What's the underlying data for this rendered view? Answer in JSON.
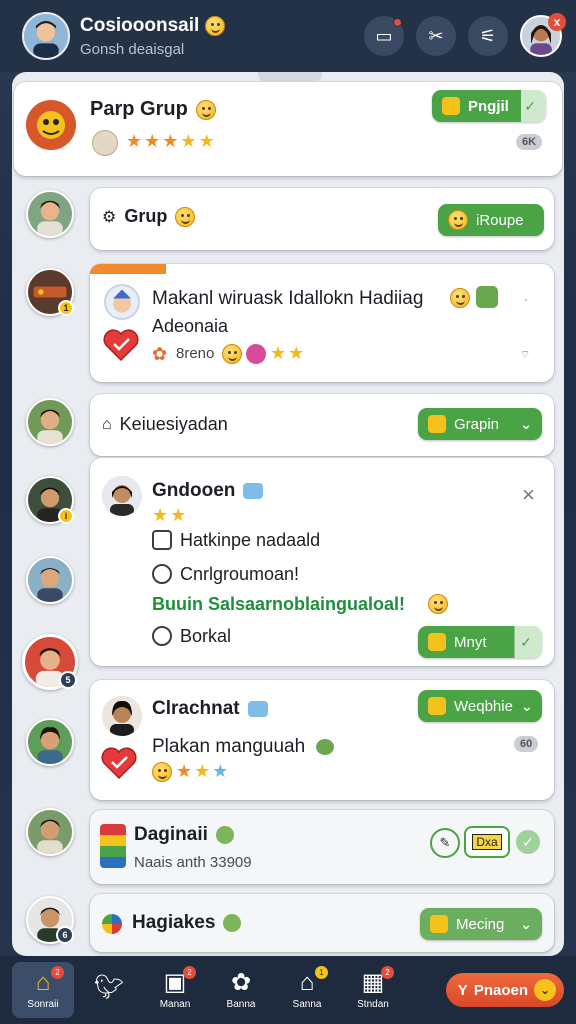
{
  "header": {
    "title": "Cosiooonsail",
    "subtitle": "Gonsh deaisgal",
    "icons": [
      "video-chat-icon",
      "tools-icon",
      "sliders-icon"
    ],
    "close_label": "x"
  },
  "rows": [
    {
      "title": "Parp Grup",
      "button_label": "Pngjil",
      "count_badge": "6K",
      "stars": 4
    },
    {
      "title": "Grup",
      "button_label": "iRoupe"
    },
    {
      "title": "Makanl wiruask Idallokn Hadiiag",
      "title_line2": "Adeonaia",
      "meta": "8reno",
      "badge": "1"
    },
    {
      "title": "Keiuesiyadan",
      "button_label": "Grapin"
    },
    {
      "title": "Gndooen",
      "options": [
        {
          "icon": "checkbox-icon",
          "label": "Hatkinpe nadaald"
        },
        {
          "icon": "radio-icon",
          "label": "Cnrlgroumoan!"
        },
        {
          "icon": "link-icon",
          "label": "Buuin Salsaarnoblaingualoal!"
        },
        {
          "icon": "shield-icon",
          "label": "Borkal"
        }
      ],
      "button_label": "Mnyt",
      "close_label": "×"
    },
    {
      "title": "Clrachnat",
      "button_label": "Weqbhie",
      "body": "Plakan manguuah",
      "count_badge": "60"
    },
    {
      "title": "Daginaii",
      "subtitle": "Naais anth 33909",
      "button_label": "Dxa"
    },
    {
      "title": "Hagiakes",
      "button_label": "Mecing"
    }
  ],
  "bottom_nav": {
    "items": [
      {
        "label": "Sonraii",
        "icon": "home-icon",
        "badge": "2"
      },
      {
        "label": "",
        "icon": "bird-icon",
        "badge": ""
      },
      {
        "label": "Manan",
        "icon": "image-icon",
        "badge": "2"
      },
      {
        "label": "Banna",
        "icon": "pet-icon",
        "badge": ""
      },
      {
        "label": "Sanna",
        "icon": "house-icon",
        "badge": "1"
      },
      {
        "label": "Stndan",
        "icon": "blocks-icon",
        "badge": "2"
      }
    ],
    "cta_label": "Pnaoen",
    "cta_prefix": "Y"
  },
  "colors": {
    "accent_green": "#4aa344",
    "header_bg": "#243247",
    "panel_bg": "#e9ecf0",
    "badge_red": "#e64b3b",
    "cta_orange": "#e3552f"
  }
}
